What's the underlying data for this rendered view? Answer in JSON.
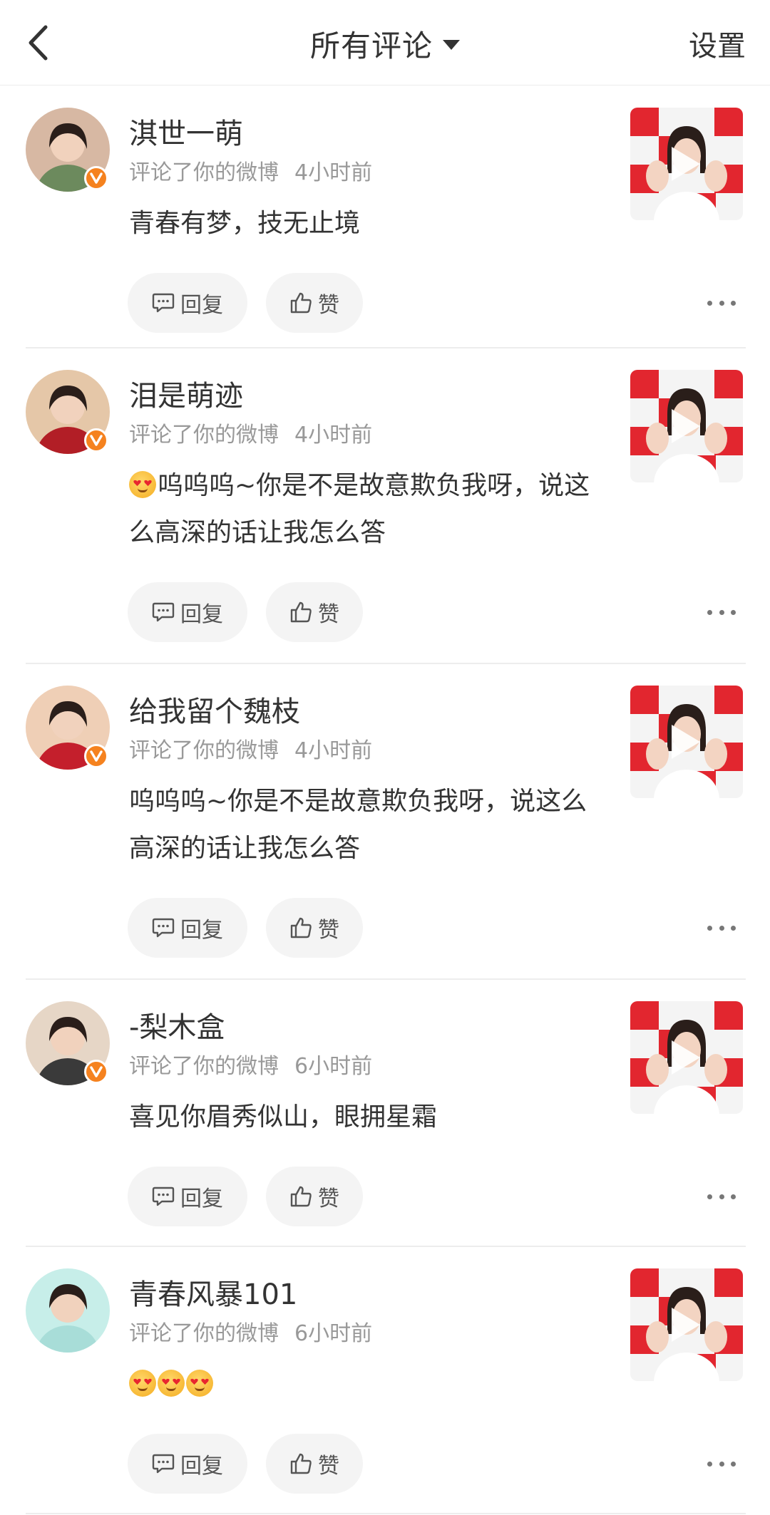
{
  "header": {
    "title": "所有评论",
    "settings_label": "设置"
  },
  "actions": {
    "reply_label": "回复",
    "like_label": "赞"
  },
  "comments": [
    {
      "username": "淇世一萌",
      "action_text": "评论了你的微博",
      "time": "4小时前",
      "text": "青春有梦，技无止境",
      "emoji_prefix": 0,
      "verified": true,
      "avatar_colors": [
        "#6c8a5d",
        "#d7b8a3"
      ]
    },
    {
      "username": "泪是萌迹",
      "action_text": "评论了你的微博",
      "time": "4小时前",
      "text": "呜呜呜~你是不是故意欺负我呀，说这么高深的话让我怎么答",
      "emoji_prefix": 1,
      "verified": true,
      "avatar_colors": [
        "#b21e26",
        "#e5c7a8"
      ]
    },
    {
      "username": "给我留个魏枝",
      "action_text": "评论了你的微博",
      "time": "4小时前",
      "text": "呜呜呜~你是不是故意欺负我呀，说这么高深的话让我怎么答",
      "emoji_prefix": 0,
      "verified": true,
      "avatar_colors": [
        "#c41f2c",
        "#efcfb6"
      ]
    },
    {
      "username": "-梨木盒",
      "action_text": "评论了你的微博",
      "time": "6小时前",
      "text": "喜见你眉秀似山，眼拥星霜",
      "emoji_prefix": 0,
      "verified": true,
      "avatar_colors": [
        "#3a3a3a",
        "#e6d6c6"
      ]
    },
    {
      "username": "青春风暴101",
      "action_text": "评论了你的微博",
      "time": "6小时前",
      "text": "",
      "emoji_prefix": 3,
      "verified": false,
      "avatar_colors": [
        "#a8ddd8",
        "#c7eee9"
      ]
    }
  ],
  "icons": {
    "back": "back-arrow-icon",
    "dropdown": "caret-down-icon",
    "reply": "comment-icon",
    "like": "thumbs-up-icon",
    "more": "more-dots-icon",
    "play": "play-icon",
    "verified": "verified-v-icon",
    "emoji": "heart-eyes-emoji"
  },
  "colors": {
    "verified_badge": "#f5821f",
    "thumbnail_red": "#e2262f",
    "meta_text": "#999999"
  }
}
